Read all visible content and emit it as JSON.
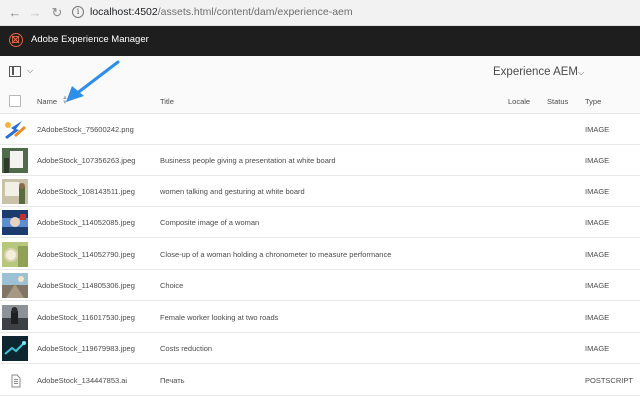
{
  "browser": {
    "url_host": "localhost:4502",
    "url_path": "/assets.html/content/dam/experience-aem"
  },
  "app": {
    "title": "Adobe Experience Manager"
  },
  "toolbar": {
    "folder_title": "Experience AEM"
  },
  "table": {
    "columns": {
      "name": "Name",
      "title": "Title",
      "locale": "Locale",
      "status": "Status",
      "type": "Type"
    },
    "rows": [
      {
        "name": "2AdobeStock_75600242.png",
        "title": "",
        "type": "IMAGE",
        "thumb": "icons-transparent"
      },
      {
        "name": "AdobeStock_107356263.jpeg",
        "title": "Business people giving a presentation at white board",
        "type": "IMAGE",
        "thumb": "whiteboard-green"
      },
      {
        "name": "AdobeStock_108143511.jpeg",
        "title": "women talking and gesturing at white board",
        "type": "IMAGE",
        "thumb": "whiteboard-beige"
      },
      {
        "name": "AdobeStock_114052085.jpeg",
        "title": "Composite image of a woman",
        "type": "IMAGE",
        "thumb": "composite-blue"
      },
      {
        "name": "AdobeStock_114052790.jpeg",
        "title": "Close-up of a woman holding a chronometer to measure performance",
        "type": "IMAGE",
        "thumb": "chronometer"
      },
      {
        "name": "AdobeStock_114805306.jpeg",
        "title": "Choice",
        "type": "IMAGE",
        "thumb": "road-sky"
      },
      {
        "name": "AdobeStock_116017530.jpeg",
        "title": "Female worker looking at two roads",
        "type": "IMAGE",
        "thumb": "woman-road"
      },
      {
        "name": "AdobeStock_119679983.jpeg",
        "title": "Costs reduction",
        "type": "IMAGE",
        "thumb": "dark-teal"
      },
      {
        "name": "AdobeStock_134447853.ai",
        "title": "Печать",
        "type": "POSTSCRIPT",
        "thumb": "document-icon"
      }
    ]
  },
  "colors": {
    "app_bar": "#1e1e1e",
    "logo_accent": "#e06640",
    "annotation_arrow": "#2f8ee8"
  }
}
